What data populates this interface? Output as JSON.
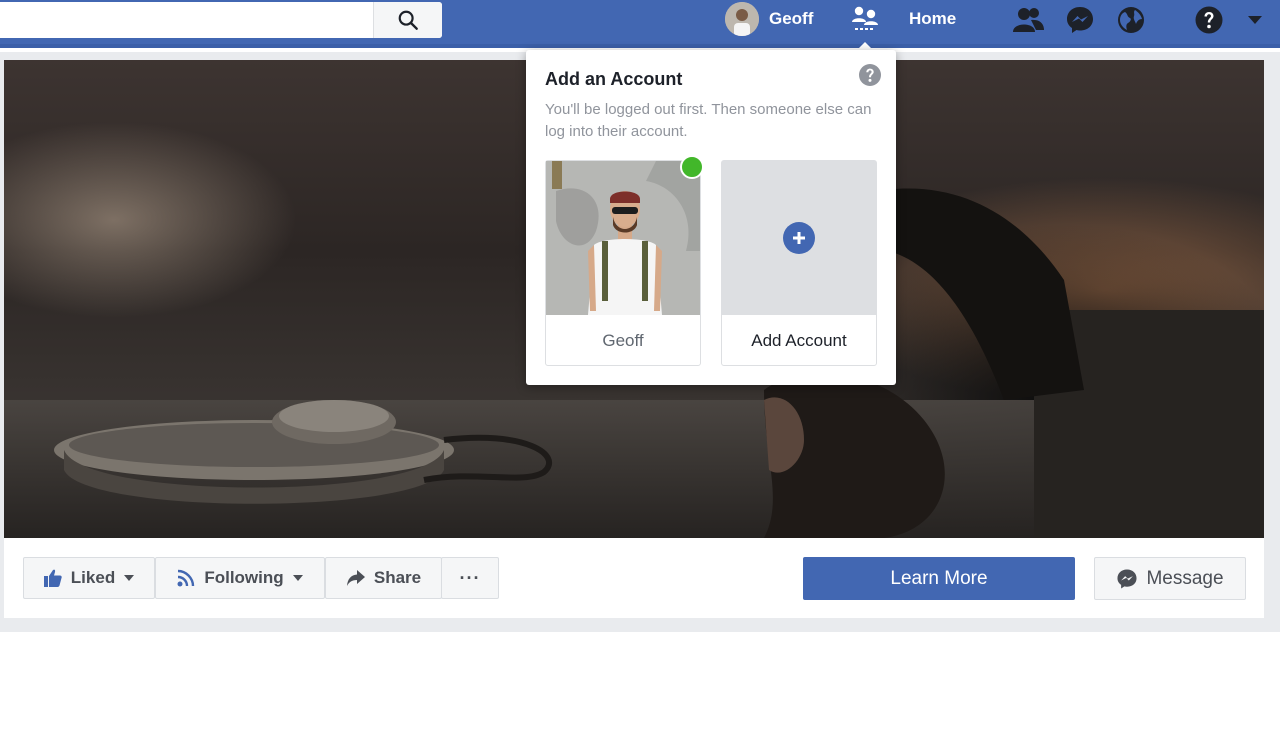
{
  "colors": {
    "brand": "#4267b2",
    "online": "#42b72a"
  },
  "topbar": {
    "search": {
      "value": "",
      "placeholder": "",
      "icon": "search-icon"
    },
    "profile_name": "Geoff",
    "home_label": "Home",
    "icons": [
      "account-switcher-icon",
      "friends-icon",
      "messenger-icon",
      "notifications-globe-icon",
      "help-icon",
      "chevron-down-icon"
    ]
  },
  "popup": {
    "title": "Add an Account",
    "description": "You'll be logged out first. Then someone else can log into their account.",
    "accounts": [
      {
        "name": "Geoff",
        "online": true
      },
      {
        "name": "Add Account"
      }
    ]
  },
  "actions": {
    "liked": "Liked",
    "following": "Following",
    "share": "Share",
    "more": "···",
    "learn_more": "Learn More",
    "message": "Message"
  }
}
